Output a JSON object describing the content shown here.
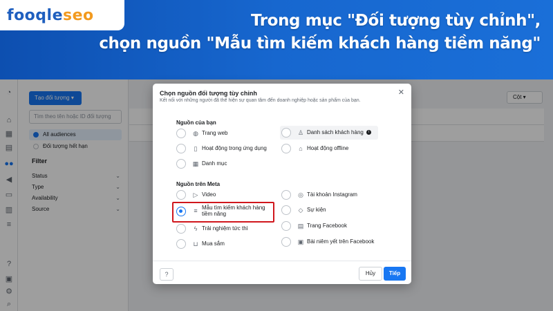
{
  "banner": {
    "logo_part1": "fooqle",
    "logo_part2": "seo",
    "headline_line1": "Trong mục \"Đối tượng tùy chỉnh\",",
    "headline_line2": "chọn nguồn \"Mẫu tìm kiếm khách hàng tiềm năng\""
  },
  "sidebar": {
    "create_button": "Tạo đối tượng ▾",
    "search_placeholder": "Tìm theo tên hoặc ID đối tượng",
    "audiences": [
      {
        "label": "All audiences",
        "selected": true
      },
      {
        "label": "Đối tượng hết hạn",
        "selected": false
      }
    ],
    "filter_title": "Filter",
    "filters": [
      "Status",
      "Type",
      "Availability",
      "Source"
    ]
  },
  "toolbar": {
    "columns_label": "Cột ▾"
  },
  "modal": {
    "title": "Chọn nguồn đối tượng tùy chỉnh",
    "subtitle": "Kết nối với những người đã thể hiện sự quan tâm đến doanh nghiệp hoặc sản phẩm của bạn.",
    "section_your_sources": "Nguồn của bạn",
    "your_sources": {
      "left": [
        {
          "label": "Trang web",
          "icon": "globe-icon"
        },
        {
          "label": "Hoạt động trong ứng dụng",
          "icon": "phone-icon"
        },
        {
          "label": "Danh mục",
          "icon": "grid-icon"
        }
      ],
      "right": [
        {
          "label": "Danh sách khách hàng",
          "icon": "person-icon"
        },
        {
          "label": "Hoạt động offline",
          "icon": "store-icon"
        }
      ]
    },
    "section_meta_sources": "Nguồn trên Meta",
    "meta_sources": {
      "left": [
        {
          "label": "Video",
          "icon": "play-icon"
        },
        {
          "label": "Mẫu tìm kiếm khách hàng tiềm năng",
          "icon": "form-icon",
          "selected": true
        },
        {
          "label": "Trải nghiệm tức thì",
          "icon": "bolt-icon"
        },
        {
          "label": "Mua sắm",
          "icon": "cart-icon"
        }
      ],
      "right": [
        {
          "label": "Tài khoản Instagram",
          "icon": "instagram-icon"
        },
        {
          "label": "Sự kiện",
          "icon": "tag-icon"
        },
        {
          "label": "Trang Facebook",
          "icon": "page-icon"
        },
        {
          "label": "Bài niêm yết trên Facebook",
          "icon": "listing-icon"
        }
      ]
    },
    "help_label": "?",
    "cancel_label": "Hủy",
    "next_label": "Tiếp"
  },
  "colors": {
    "banner_blue": "#1767cf",
    "primary_button": "#1877f2",
    "highlight_red": "#d0161c",
    "logo_orange": "#f29a1f"
  }
}
